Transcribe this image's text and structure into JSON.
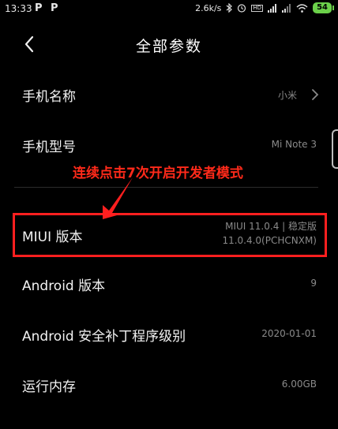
{
  "status_bar": {
    "time": "13:33",
    "app_icon_1": "P",
    "app_icon_2": "P",
    "network_speed": "2.6k/s",
    "hd_label": "HD",
    "battery": "54"
  },
  "header": {
    "title": "全部参数",
    "back_icon": "chevron-left-icon"
  },
  "rows": [
    {
      "label": "手机名称",
      "value": "小米",
      "chevron": true
    },
    {
      "label": "手机型号",
      "value": "Mi Note 3"
    },
    {
      "label": "MIUI 版本",
      "value_line1": "MIUI 11.0.4 | 稳定版",
      "value_line2": "11.0.4.0(PCHCNXM)"
    },
    {
      "label": "Android 版本",
      "value": "9"
    },
    {
      "label": "Android 安全补丁程序级别",
      "value": "2020-01-01"
    },
    {
      "label": "运行内存",
      "value": "6.00GB"
    }
  ],
  "annotation": {
    "text": "连续点击7次开启开发者模式",
    "color": "#ff2a1a"
  },
  "colors": {
    "background": "#000000",
    "battery": "#6bd04a",
    "annotation_red": "#ff1f1f"
  }
}
